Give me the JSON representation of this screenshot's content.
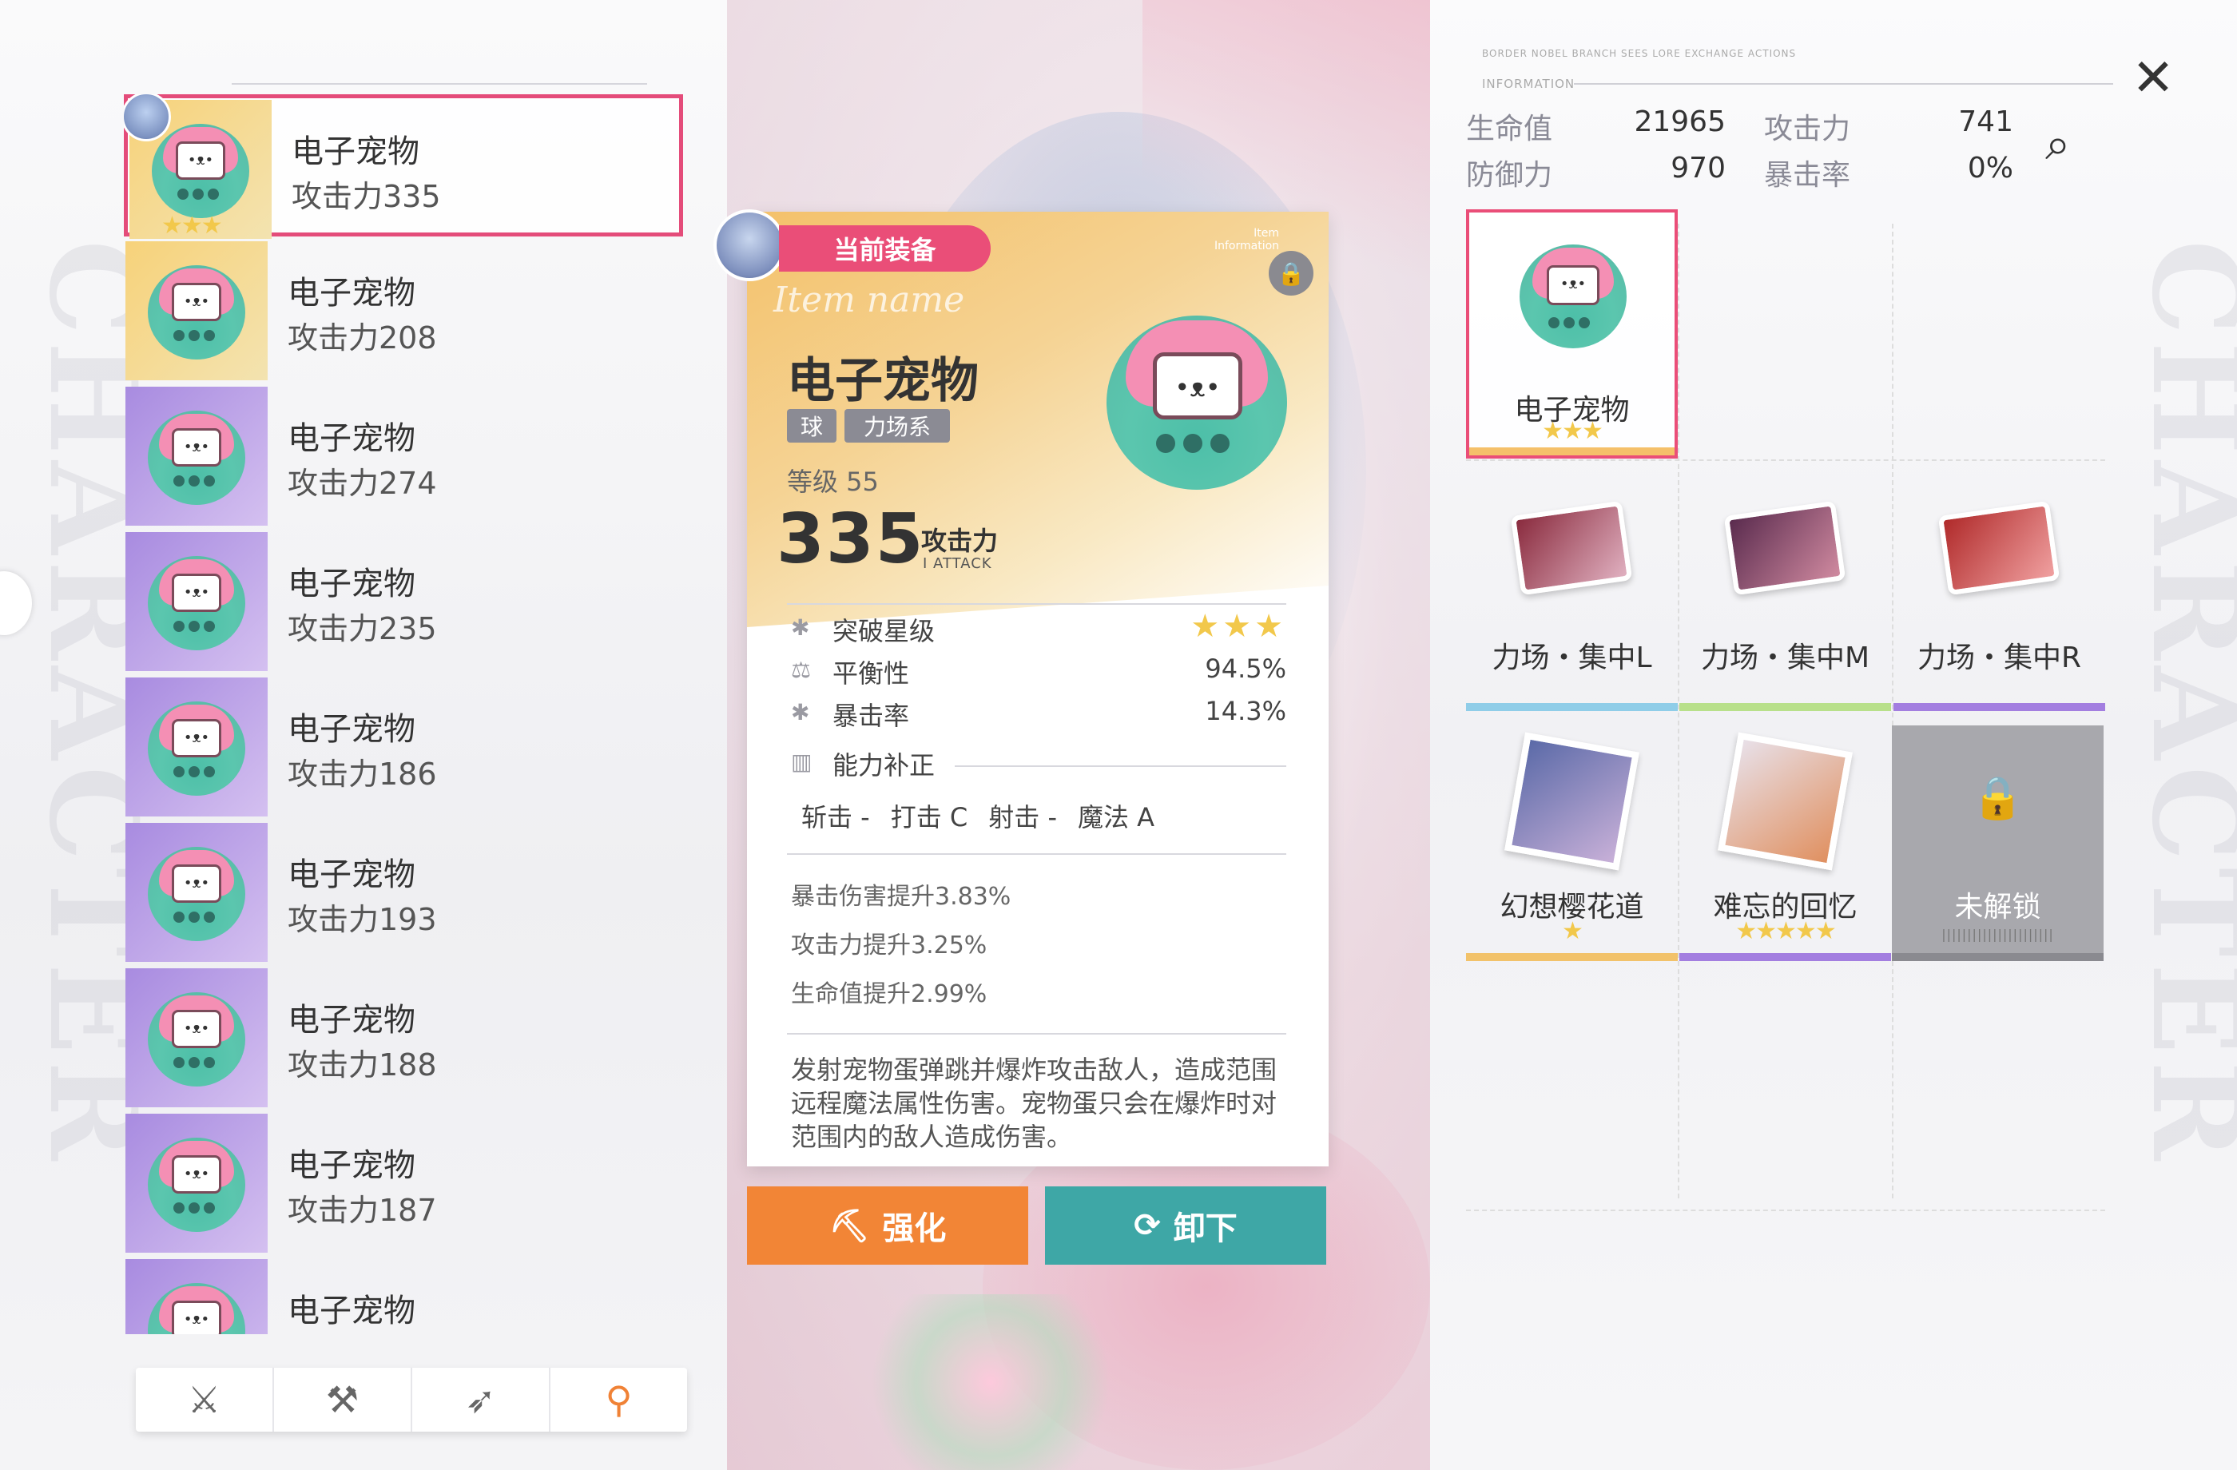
{
  "colors": {
    "accent_pink": "#ea4e78",
    "enhance_orange": "#f28536",
    "unequip_teal": "#3ea7a6",
    "star_gold": "#f2c84b",
    "rarity_gold": "#f5d07a",
    "rarity_purple": "#b49be6",
    "bar_blue": "#8fcde8",
    "bar_green": "#b8e08a",
    "bar_purple": "#a37ee0",
    "bar_orange": "#f2c26a"
  },
  "background": {
    "watermark": "CHARACTER"
  },
  "weapon_list": {
    "items": [
      {
        "name": "电子宠物",
        "atk": "攻击力335",
        "rarity": "gold",
        "selected": true,
        "stars": "★★★"
      },
      {
        "name": "电子宠物",
        "atk": "攻击力208",
        "rarity": "gold"
      },
      {
        "name": "电子宠物",
        "atk": "攻击力274",
        "rarity": "purple"
      },
      {
        "name": "电子宠物",
        "atk": "攻击力235",
        "rarity": "purple"
      },
      {
        "name": "电子宠物",
        "atk": "攻击力186",
        "rarity": "purple"
      },
      {
        "name": "电子宠物",
        "atk": "攻击力193",
        "rarity": "purple"
      },
      {
        "name": "电子宠物",
        "atk": "攻击力188",
        "rarity": "purple"
      },
      {
        "name": "电子宠物",
        "atk": "攻击力187",
        "rarity": "purple"
      },
      {
        "name": "电子宠物",
        "atk": "",
        "rarity": "purple"
      }
    ],
    "pet_face": "•ᴥ•",
    "tabs": [
      {
        "icon": "sword-icon",
        "glyph": "⚔"
      },
      {
        "icon": "hammer-icon",
        "glyph": "⚒"
      },
      {
        "icon": "gun-icon",
        "glyph": "➶"
      },
      {
        "icon": "wand-icon",
        "glyph": "⚲"
      }
    ]
  },
  "equip_card": {
    "tag": "当前装备",
    "info_label_1": "Item",
    "info_label_2": "Information",
    "script_label": "Item name",
    "title": "电子宠物",
    "chips": [
      "球",
      "力场系"
    ],
    "level": "等级 55",
    "atk_value": "335",
    "atk_label": "攻击力",
    "atk_sub": "I ATTACK",
    "stats": [
      {
        "icon": "star-icon",
        "glyph": "✱",
        "label": "突破星级",
        "value": ""
      },
      {
        "icon": "balance-icon",
        "glyph": "⚖",
        "label": "平衡性",
        "value": "94.5%"
      },
      {
        "icon": "crit-icon",
        "glyph": "✱",
        "label": "暴击率",
        "value": "14.3%"
      }
    ],
    "break_stars": "★★★",
    "ability_icon": "▥",
    "ability_title": "能力补正",
    "abilities": [
      "斩击  -",
      "打击  C",
      "射击  -",
      "魔法  A"
    ],
    "bonuses": [
      "暴击伤害提升3.83%",
      "攻击力提升3.25%",
      "生命值提升2.99%"
    ],
    "description": "发射宠物蛋弹跳并爆炸攻击敌人，造成范围远程魔法属性伤害。宠物蛋只会在爆炸时对范围内的敌人造成伤害。",
    "enhance_label": "强化",
    "unequip_label": "卸下",
    "enhance_icon": "⛏",
    "unequip_icon": "⟳"
  },
  "stats_panel": {
    "caption": "INFORMATION",
    "tiny_text": "BORDER NOBEL BRANCH SEES LORE EXCHANGE ACTIONS",
    "hp_label": "生命值",
    "hp_value": "21965",
    "atk_label": "攻击力",
    "atk_value": "741",
    "def_label": "防御力",
    "def_value": "970",
    "crit_label": "暴击率",
    "crit_value": "0%",
    "close_glyph": "✕",
    "detail_glyph": "⌕"
  },
  "slots": {
    "weapon": {
      "name": "电子宠物",
      "stars": "★★★"
    },
    "force1": {
      "name": "力场・集中L"
    },
    "force2": {
      "name": "力场・集中M"
    },
    "force3": {
      "name": "力场・集中R"
    },
    "mem1": {
      "name": "幻想樱花道",
      "stars": "★"
    },
    "mem2": {
      "name": "难忘的回忆",
      "stars": "★★★★★"
    },
    "locked": {
      "name": "未解锁",
      "glyph": "🔒",
      "barcode": "||||||||||||||||||||||"
    }
  }
}
